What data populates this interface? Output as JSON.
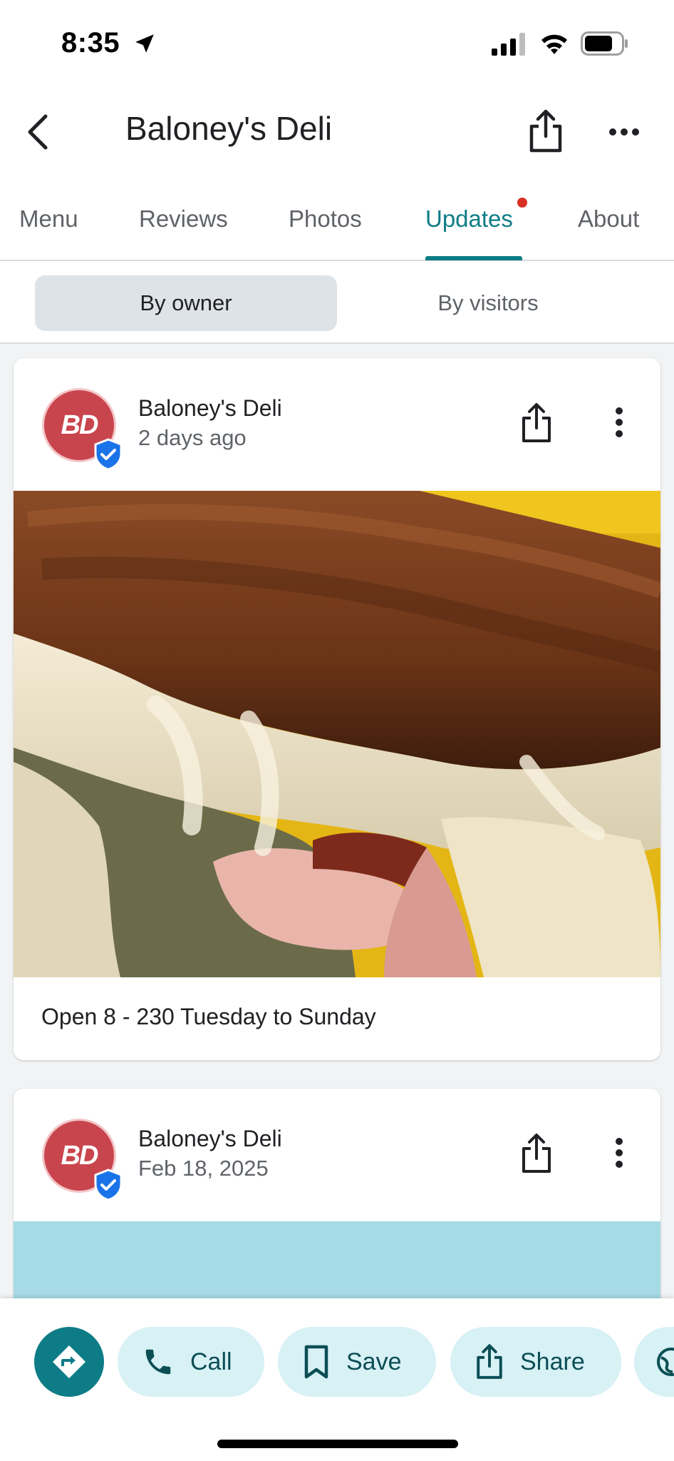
{
  "status_bar": {
    "time": "8:35"
  },
  "header": {
    "title": "Baloney's Deli"
  },
  "tabs": [
    {
      "label": "Menu"
    },
    {
      "label": "Reviews"
    },
    {
      "label": "Photos"
    },
    {
      "label": "Updates"
    },
    {
      "label": "About"
    }
  ],
  "active_tab": "Updates",
  "segments": {
    "owner": "By owner",
    "visitors": "By visitors"
  },
  "avatar_initials": "BD",
  "posts": [
    {
      "author": "Baloney's Deli",
      "date": "2 days ago",
      "text": "Open 8 - 230 Tuesday to Sunday"
    },
    {
      "author": "Baloney's Deli",
      "date": "Feb 18, 2025"
    }
  ],
  "actions": {
    "call": "Call",
    "save": "Save",
    "share": "Share"
  },
  "colors": {
    "accent": "#0e7c86",
    "pill_bg": "#d7f1f5",
    "avatar": "#c9454e",
    "badge": "#1a73e8",
    "notification_dot": "#d93025"
  }
}
